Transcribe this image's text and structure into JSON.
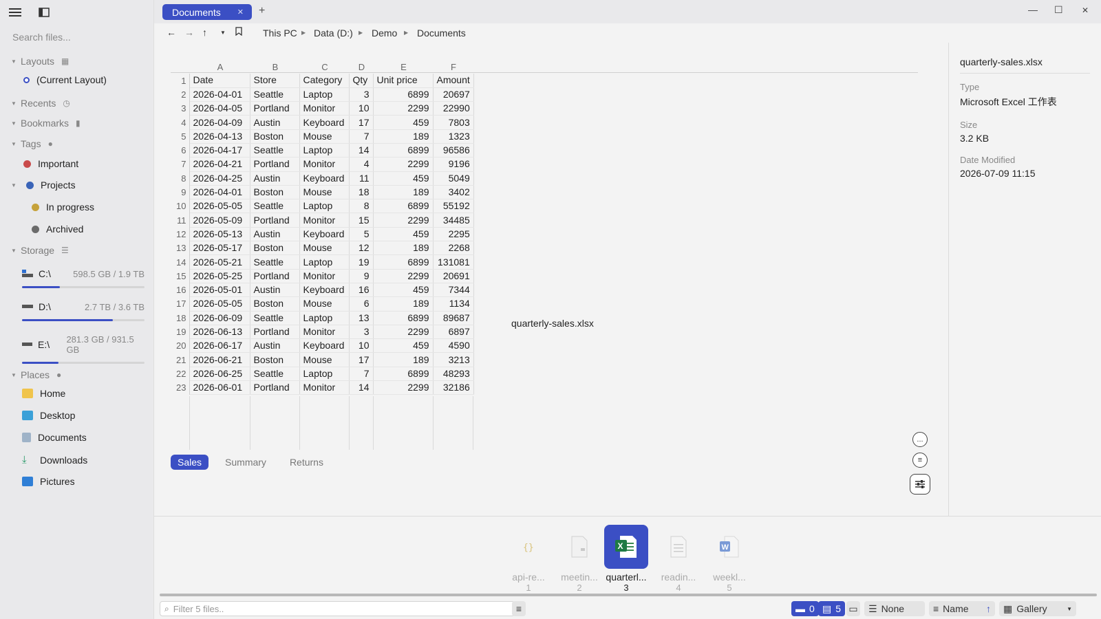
{
  "sidebar": {
    "search_placeholder": "Search files...",
    "layouts": {
      "label": "Layouts",
      "items": [
        "(Current Layout)"
      ]
    },
    "recents": {
      "label": "Recents"
    },
    "bookmarks": {
      "label": "Bookmarks"
    },
    "tags": {
      "label": "Tags",
      "items": [
        {
          "label": "Important",
          "color": "#c94a4a"
        },
        {
          "label": "Projects",
          "color": "#3a64b8"
        },
        {
          "label": "In progress",
          "color": "#c6a23a"
        },
        {
          "label": "Archived",
          "color": "#6b6b6b"
        }
      ]
    },
    "storage": {
      "label": "Storage",
      "drives": [
        {
          "name": "C:\\",
          "size": "598.5 GB / 1.9 TB",
          "used": 0.31
        },
        {
          "name": "D:\\",
          "size": "2.7 TB / 3.6 TB",
          "used": 0.74
        },
        {
          "name": "E:\\",
          "size": "281.3 GB / 931.5 GB",
          "used": 0.3
        }
      ]
    },
    "places": {
      "label": "Places",
      "items": [
        "Home",
        "Desktop",
        "Documents",
        "Downloads",
        "Pictures"
      ]
    }
  },
  "titlebar": {
    "tab_label": "Documents",
    "add_tab": "+"
  },
  "address": {
    "crumbs": [
      "This PC",
      "Data (D:)",
      "Demo",
      "Documents"
    ]
  },
  "sheet": {
    "col_letters": [
      "A",
      "B",
      "C",
      "D",
      "E",
      "F"
    ],
    "rows": [
      [
        "Date",
        "Store",
        "Category",
        "Qty",
        "Unit price",
        "Amount"
      ],
      [
        "2026-04-01",
        "Seattle",
        "Laptop",
        "3",
        "6899",
        "20697"
      ],
      [
        "2026-04-05",
        "Portland",
        "Monitor",
        "10",
        "2299",
        "22990"
      ],
      [
        "2026-04-09",
        "Austin",
        "Keyboard",
        "17",
        "459",
        "7803"
      ],
      [
        "2026-04-13",
        "Boston",
        "Mouse",
        "7",
        "189",
        "1323"
      ],
      [
        "2026-04-17",
        "Seattle",
        "Laptop",
        "14",
        "6899",
        "96586"
      ],
      [
        "2026-04-21",
        "Portland",
        "Monitor",
        "4",
        "2299",
        "9196"
      ],
      [
        "2026-04-25",
        "Austin",
        "Keyboard",
        "11",
        "459",
        "5049"
      ],
      [
        "2026-04-01",
        "Boston",
        "Mouse",
        "18",
        "189",
        "3402"
      ],
      [
        "2026-05-05",
        "Seattle",
        "Laptop",
        "8",
        "6899",
        "55192"
      ],
      [
        "2026-05-09",
        "Portland",
        "Monitor",
        "15",
        "2299",
        "34485"
      ],
      [
        "2026-05-13",
        "Austin",
        "Keyboard",
        "5",
        "459",
        "2295"
      ],
      [
        "2026-05-17",
        "Boston",
        "Mouse",
        "12",
        "189",
        "2268"
      ],
      [
        "2026-05-21",
        "Seattle",
        "Laptop",
        "19",
        "6899",
        "131081"
      ],
      [
        "2026-05-25",
        "Portland",
        "Monitor",
        "9",
        "2299",
        "20691"
      ],
      [
        "2026-05-01",
        "Austin",
        "Keyboard",
        "16",
        "459",
        "7344"
      ],
      [
        "2026-05-05",
        "Boston",
        "Mouse",
        "6",
        "189",
        "1134"
      ],
      [
        "2026-06-09",
        "Seattle",
        "Laptop",
        "13",
        "6899",
        "89687"
      ],
      [
        "2026-06-13",
        "Portland",
        "Monitor",
        "3",
        "2299",
        "6897"
      ],
      [
        "2026-06-17",
        "Austin",
        "Keyboard",
        "10",
        "459",
        "4590"
      ],
      [
        "2026-06-21",
        "Boston",
        "Mouse",
        "17",
        "189",
        "3213"
      ],
      [
        "2026-06-25",
        "Seattle",
        "Laptop",
        "7",
        "6899",
        "48293"
      ],
      [
        "2026-06-01",
        "Portland",
        "Monitor",
        "14",
        "2299",
        "32186"
      ]
    ],
    "sheet_tabs": [
      "Sales",
      "Summary",
      "Returns"
    ],
    "active_tab": "Sales",
    "floating_filename": "quarterly-sales.xlsx",
    "more_button": "..."
  },
  "details": {
    "filename": "quarterly-sales.xlsx",
    "type_label": "Type",
    "type_value": "Microsoft Excel 工作表",
    "size_label": "Size",
    "size_value": "3.2 KB",
    "modified_label": "Date Modified",
    "modified_value": "2026-07-09 11:15"
  },
  "gallery": {
    "items": [
      {
        "name": "api-re...",
        "num": "1",
        "icon": "json-file-icon"
      },
      {
        "name": "meetin...",
        "num": "2",
        "icon": "text-file-icon"
      },
      {
        "name": "quarterl...",
        "num": "3",
        "icon": "excel-file-icon"
      },
      {
        "name": "readin...",
        "num": "4",
        "icon": "document-file-icon"
      },
      {
        "name": "weekl...",
        "num": "5",
        "icon": "word-file-icon"
      }
    ],
    "selected_index": 2
  },
  "status": {
    "filter_placeholder": "Filter 5 files..",
    "folder_count": "0",
    "file_count": "5",
    "group_label": "None",
    "sort_label": "Name",
    "sort_dir": "↑",
    "view_label": "Gallery"
  },
  "colors": {
    "accent": "#3b4fc4",
    "sidebar_bg": "#e9e9eb",
    "content_bg": "#f3f3f3"
  }
}
